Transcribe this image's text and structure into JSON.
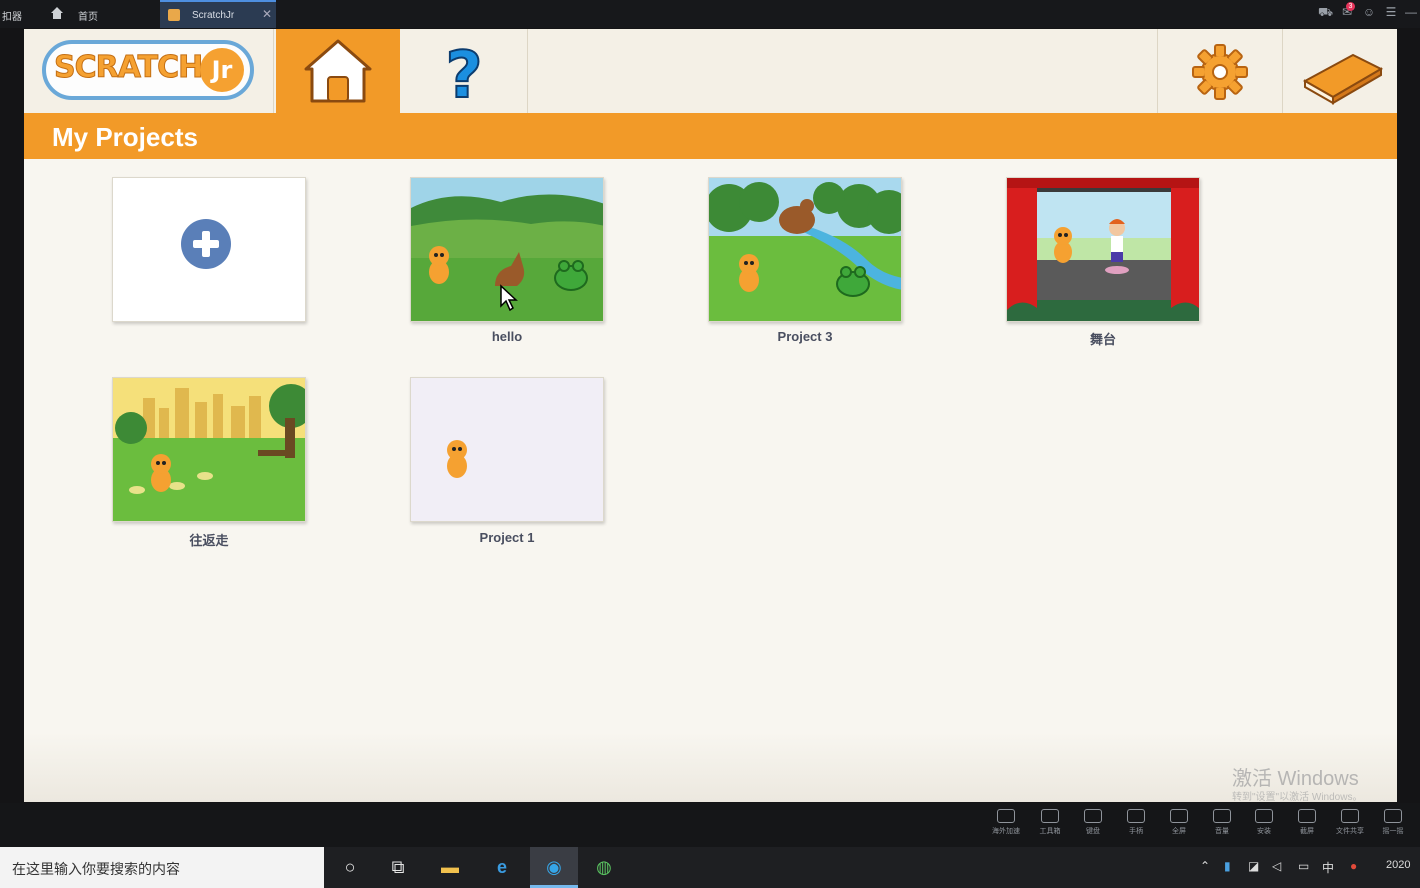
{
  "emulator": {
    "app_name": "扣器",
    "home_tab_label": "首页",
    "active_tab_label": "ScratchJr",
    "notification_count": "3"
  },
  "app": {
    "logo_text": "SCRATCH",
    "logo_suffix": "Jr",
    "nav": {
      "home_icon": "house-icon",
      "help_icon": "question-icon",
      "settings_icon": "gear-icon",
      "book_icon": "book-icon"
    },
    "page_title": "My Projects",
    "new_project_icon": "plus-circle-icon",
    "projects": [
      {
        "name": "hello",
        "scene": "farm"
      },
      {
        "name": "Project 3",
        "scene": "forest-river"
      },
      {
        "name": "舞台",
        "scene": "theater"
      },
      {
        "name": "往返走",
        "scene": "city-park"
      },
      {
        "name": "Project 1",
        "scene": "blank"
      }
    ]
  },
  "toolbar": {
    "items": [
      "海外加速",
      "工具箱",
      "键盘",
      "手柄",
      "全屏",
      "音量",
      "安装",
      "截屏",
      "文件共享",
      "摇一摇"
    ]
  },
  "watermark": {
    "line1": "激活 Windows",
    "line2": "转到\"设置\"以激活 Windows。"
  },
  "taskbar": {
    "search_placeholder": "在这里输入你要搜索的内容",
    "ime": "中",
    "clock": "2020"
  },
  "colors": {
    "accent_orange": "#f29a28",
    "canvas": "#f8f6f0",
    "label_text": "#4a4f60"
  }
}
